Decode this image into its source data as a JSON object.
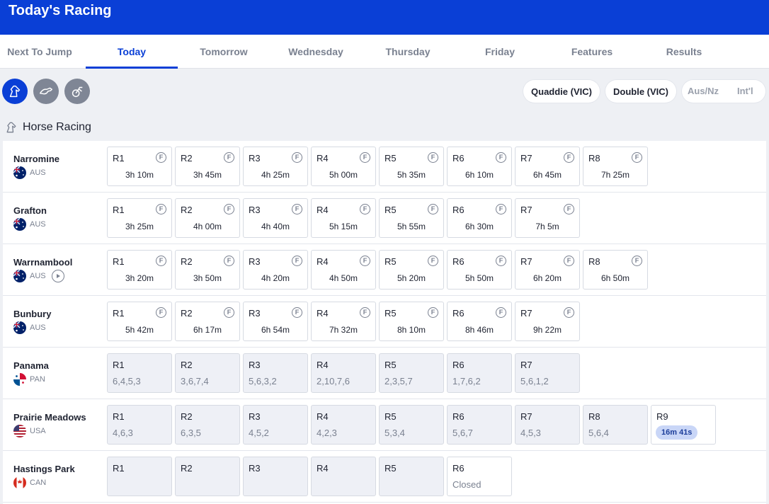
{
  "header": {
    "title": "Today's Racing"
  },
  "tabs": [
    {
      "label": "Next To Jump"
    },
    {
      "label": "Today"
    },
    {
      "label": "Tomorrow"
    },
    {
      "label": "Wednesday"
    },
    {
      "label": "Thursday"
    },
    {
      "label": "Friday"
    },
    {
      "label": "Features"
    },
    {
      "label": "Results"
    }
  ],
  "active_tab": "Today",
  "race_types": [
    "horse-icon",
    "greyhound-icon",
    "harness-icon"
  ],
  "toolbar": {
    "quaddie_label": "Quaddie (VIC)",
    "double_label": "Double (VIC)",
    "region_ausnz": "Aus/Nz",
    "region_intl": "Int'l"
  },
  "section": {
    "title": "Horse Racing"
  },
  "meetings": [
    {
      "venue": "Narromine",
      "country": "AUS",
      "races": [
        {
          "label": "R1",
          "time": "3h 10m"
        },
        {
          "label": "R2",
          "time": "3h 45m"
        },
        {
          "label": "R3",
          "time": "4h 25m"
        },
        {
          "label": "R4",
          "time": "5h 00m"
        },
        {
          "label": "R5",
          "time": "5h 35m"
        },
        {
          "label": "R6",
          "time": "6h 10m"
        },
        {
          "label": "R7",
          "time": "6h 45m"
        },
        {
          "label": "R8",
          "time": "7h 25m"
        }
      ]
    },
    {
      "venue": "Grafton",
      "country": "AUS",
      "races": [
        {
          "label": "R1",
          "time": "3h 25m"
        },
        {
          "label": "R2",
          "time": "4h 00m"
        },
        {
          "label": "R3",
          "time": "4h 40m"
        },
        {
          "label": "R4",
          "time": "5h 15m"
        },
        {
          "label": "R5",
          "time": "5h 55m"
        },
        {
          "label": "R6",
          "time": "6h 30m"
        },
        {
          "label": "R7",
          "time": "7h 5m"
        }
      ]
    },
    {
      "venue": "Warrnambool",
      "country": "AUS",
      "stream": true,
      "races": [
        {
          "label": "R1",
          "time": "3h 20m"
        },
        {
          "label": "R2",
          "time": "3h 50m"
        },
        {
          "label": "R3",
          "time": "4h 20m"
        },
        {
          "label": "R4",
          "time": "4h 50m"
        },
        {
          "label": "R5",
          "time": "5h 20m"
        },
        {
          "label": "R6",
          "time": "5h 50m"
        },
        {
          "label": "R7",
          "time": "6h 20m"
        },
        {
          "label": "R8",
          "time": "6h 50m"
        }
      ]
    },
    {
      "venue": "Bunbury",
      "country": "AUS",
      "races": [
        {
          "label": "R1",
          "time": "5h 42m"
        },
        {
          "label": "R2",
          "time": "6h 17m"
        },
        {
          "label": "R3",
          "time": "6h 54m"
        },
        {
          "label": "R4",
          "time": "7h 32m"
        },
        {
          "label": "R5",
          "time": "8h 10m"
        },
        {
          "label": "R6",
          "time": "8h 46m"
        },
        {
          "label": "R7",
          "time": "9h 22m"
        }
      ]
    },
    {
      "venue": "Panama",
      "country": "PAN",
      "races": [
        {
          "label": "R1",
          "result": "6,4,5,3"
        },
        {
          "label": "R2",
          "result": "3,6,7,4"
        },
        {
          "label": "R3",
          "result": "5,6,3,2"
        },
        {
          "label": "R4",
          "result": "2,10,7,6"
        },
        {
          "label": "R5",
          "result": "2,3,5,7"
        },
        {
          "label": "R6",
          "result": "1,7,6,2"
        },
        {
          "label": "R7",
          "result": "5,6,1,2"
        }
      ]
    },
    {
      "venue": "Prairie Meadows",
      "country": "USA",
      "races": [
        {
          "label": "R1",
          "result": "4,6,3"
        },
        {
          "label": "R2",
          "result": "6,3,5"
        },
        {
          "label": "R3",
          "result": "4,5,2"
        },
        {
          "label": "R4",
          "result": "4,2,3"
        },
        {
          "label": "R5",
          "result": "5,3,4"
        },
        {
          "label": "R6",
          "result": "5,6,7"
        },
        {
          "label": "R7",
          "result": "4,5,3"
        },
        {
          "label": "R8",
          "result": "5,6,4"
        },
        {
          "label": "R9",
          "countdown": "16m 41s"
        }
      ]
    },
    {
      "venue": "Hastings Park",
      "country": "CAN",
      "races": [
        {
          "label": "R1",
          "result": ""
        },
        {
          "label": "R2",
          "result": ""
        },
        {
          "label": "R3",
          "result": ""
        },
        {
          "label": "R4",
          "result": ""
        },
        {
          "label": "R5",
          "result": ""
        },
        {
          "label": "R6",
          "status": "Closed"
        }
      ]
    }
  ],
  "fixed_odds_marker": "F",
  "colors": {
    "brand": "#0a3fd6",
    "countdown_badge": "#c9d6f7"
  }
}
